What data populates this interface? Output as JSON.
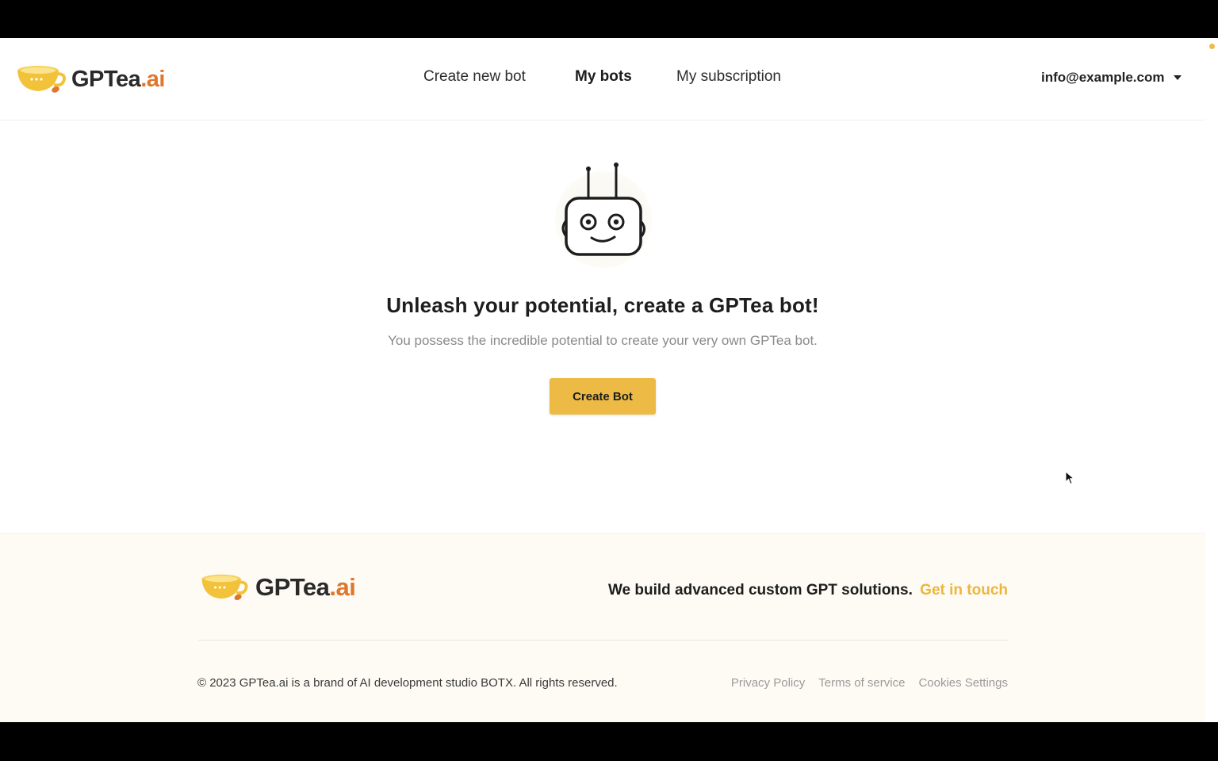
{
  "brand": {
    "name_main": "GPTea",
    "name_dot": ".",
    "name_ai": "ai",
    "accent_color": "#edbb45",
    "ai_color": "#e0762b",
    "logo_icon": "teacup-icon"
  },
  "header": {
    "nav": [
      {
        "label": "Create new bot",
        "active": false
      },
      {
        "label": "My bots",
        "active": true
      },
      {
        "label": "My subscription",
        "active": false
      }
    ],
    "user_email": "info@example.com",
    "user_menu_icon": "caret-down-icon"
  },
  "main": {
    "illustration_icon": "robot-icon",
    "headline": "Unleash your potential, create a GPTea bot!",
    "subline": "You possess the incredible potential to create your very own GPTea bot.",
    "cta_label": "Create Bot"
  },
  "footer": {
    "tagline": "We build advanced custom GPT solutions.",
    "contact_link": "Get in touch",
    "copyright": "© 2023 GPTea.ai is a brand of AI development studio BOTX. All rights reserved.",
    "links": [
      "Privacy Policy",
      "Terms of service",
      "Cookies Settings"
    ]
  }
}
